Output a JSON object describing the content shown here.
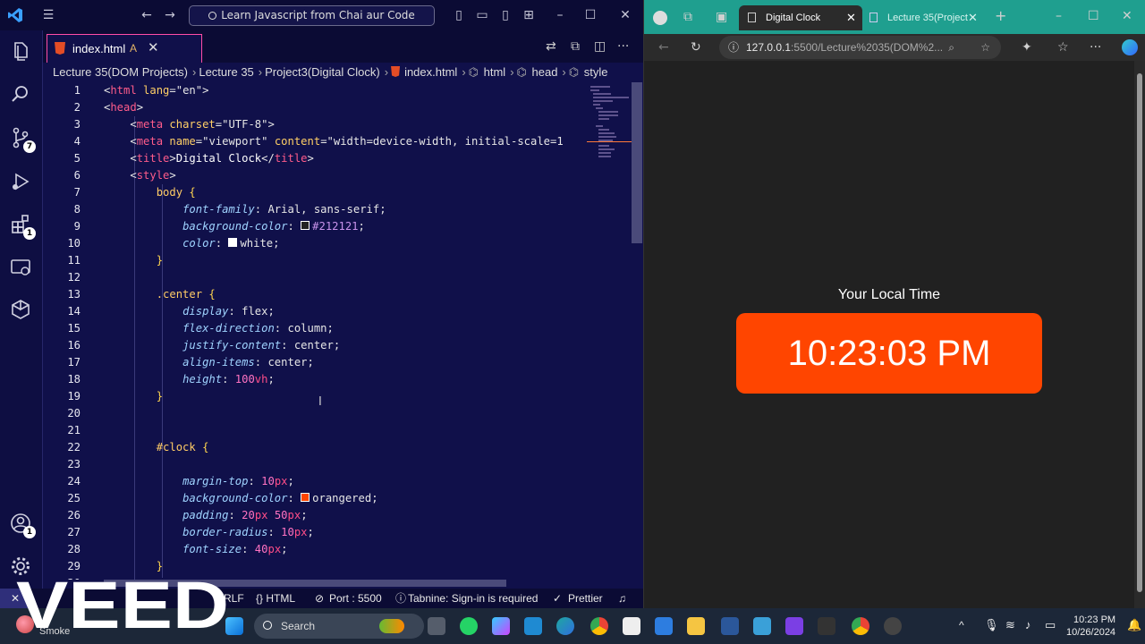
{
  "vscode": {
    "command_center": "Learn Javascript from Chai aur Code",
    "tab": {
      "label": "index.html",
      "modified": "A"
    },
    "breadcrumb": [
      "Lecture 35(DOM Projects)",
      "Lecture 35",
      "Project3(Digital Clock)",
      "index.html",
      "html",
      "head",
      "style"
    ],
    "activity_badges": {
      "source_control": "7",
      "extensions": "1",
      "accounts": "1"
    },
    "status": {
      "remote": "",
      "eol": "RLF",
      "language": "{} HTML",
      "port": "Port : 5500",
      "tabnine": "Tabnine: Sign-in is required",
      "prettier": "Prettier"
    },
    "lines": [
      "1",
      "2",
      "3",
      "4",
      "5",
      "6",
      "7",
      "8",
      "9",
      "10",
      "11",
      "12",
      "13",
      "14",
      "15",
      "16",
      "17",
      "18",
      "19",
      "20",
      "21",
      "22",
      "23",
      "24",
      "25",
      "26",
      "27",
      "28",
      "29",
      "30"
    ]
  },
  "code": {
    "l1_tag": "html",
    "l1_attr": "lang",
    "l1_val": "\"en\"",
    "l2_tag": "head",
    "l3_tag": "meta",
    "l3_attr": "charset",
    "l3_val": "\"UTF-8\"",
    "l4_tag": "meta",
    "l4_attr1": "name",
    "l4_val1": "\"viewport\"",
    "l4_attr2": "content",
    "l4_val2": "\"width=device-width, initial-scale=1",
    "l5_tag": "title",
    "l5_text": "Digital Clock",
    "l6_tag": "style",
    "l7_sel": "body",
    "l8_prop": "font-family",
    "l8_val": "Arial, sans-serif",
    "l9_prop": "background-color",
    "l9_val": "#212121",
    "l10_prop": "color",
    "l10_val": "white",
    "l13_sel": ".center",
    "l14_prop": "display",
    "l14_val": "flex",
    "l15_prop": "flex-direction",
    "l15_val": "column",
    "l16_prop": "justify-content",
    "l16_val": "center",
    "l17_prop": "align-items",
    "l17_val": "center",
    "l18_prop": "height",
    "l18_num": "100",
    "l18_unit": "vh",
    "l22_sel": "#clock",
    "l24_prop": "margin-top",
    "l24_num": "10",
    "l24_unit": "px",
    "l25_prop": "background-color",
    "l25_val": "orangered",
    "l26_prop": "padding",
    "l26_num1": "20",
    "l26_unit1": "px",
    "l26_num2": "50",
    "l26_unit2": "px",
    "l27_prop": "border-radius",
    "l27_num": "10",
    "l27_unit": "px",
    "l28_prop": "font-size",
    "l28_num": "40",
    "l28_unit": "px"
  },
  "browser": {
    "active_tab": "Digital Clock",
    "inactive_tab": "Lecture 35(Project",
    "address_host": "127.0.0.1",
    "address_path": ":5500/Lecture%2035(DOM%2...",
    "page_heading": "Your Local Time",
    "clock_text": "10:23:03 PM"
  },
  "taskbar": {
    "search_placeholder": "Search",
    "weather": "Smoke",
    "time": "10:23 PM",
    "date": "10/26/2024"
  },
  "watermark": "VEED",
  "colors": {
    "orangered": "#ff4500",
    "body_bg": "#212121",
    "editor_bg": "#10104a",
    "edge_tab": "#1f9f8f"
  }
}
